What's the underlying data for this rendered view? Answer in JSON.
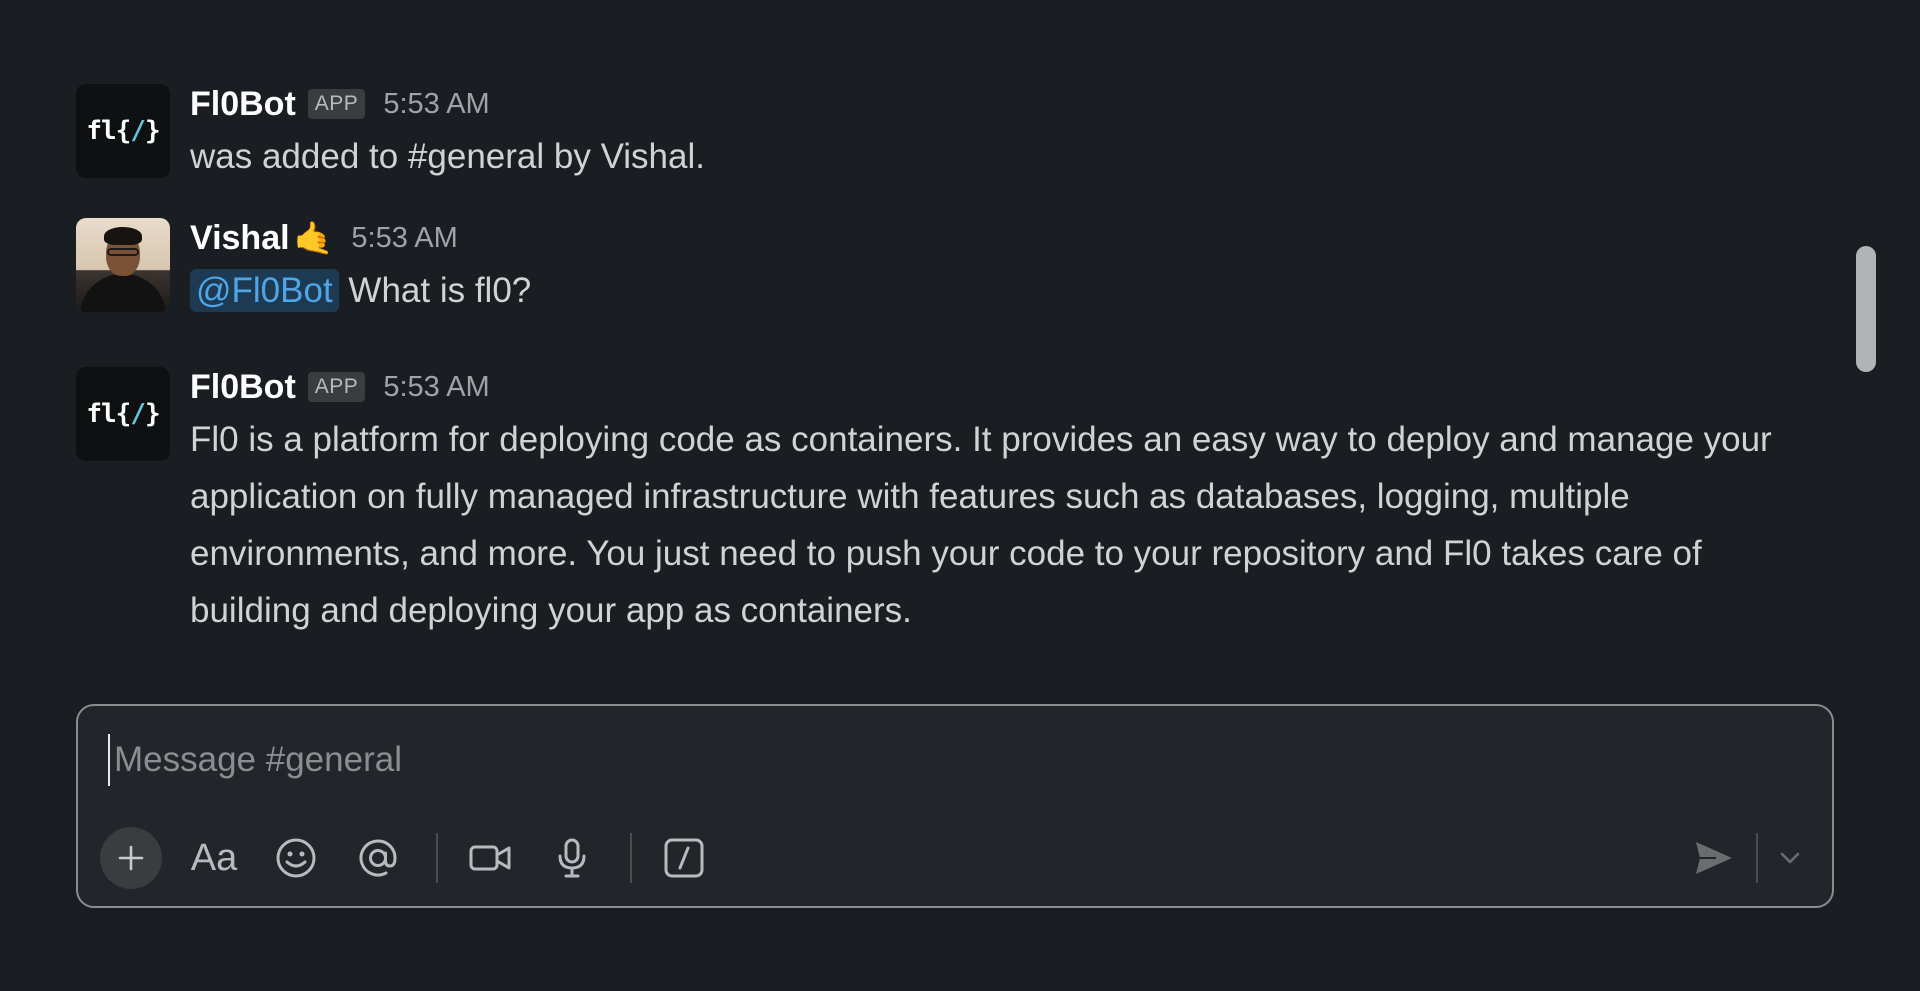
{
  "channel": "general",
  "messages": [
    {
      "sender": "Fl0Bot",
      "badge": "APP",
      "time": "5:53 AM",
      "avatar": "fl0-logo",
      "text": "was added to #general by Vishal."
    },
    {
      "sender": "Vishal",
      "emoji": "🤙",
      "time": "5:53 AM",
      "avatar": "user-photo",
      "mention": "@Fl0Bot",
      "text": "What is fl0?"
    },
    {
      "sender": "Fl0Bot",
      "badge": "APP",
      "time": "5:53 AM",
      "avatar": "fl0-logo",
      "text": "Fl0 is a platform for deploying code as containers. It provides an easy way to deploy and manage your application on fully managed infrastructure with features such as databases, logging, multiple environments, and more. You just need to push your code to your repository and Fl0 takes care of building and deploying your app as containers."
    }
  ],
  "bot_logo": {
    "left": "fl{",
    "slash": "/",
    "right": "}"
  },
  "composer": {
    "placeholder": "Message #general",
    "value": "",
    "format_label": "Aa"
  },
  "toolbar_icons": [
    "plus-icon",
    "text-format-icon",
    "emoji-icon",
    "mention-icon",
    "video-icon",
    "microphone-icon",
    "slash-command-icon",
    "send-icon",
    "chevron-down-icon"
  ],
  "colors": {
    "background": "#1a1d21",
    "mention": "#4fa5e6",
    "mention_bg": "#1d3a52"
  }
}
